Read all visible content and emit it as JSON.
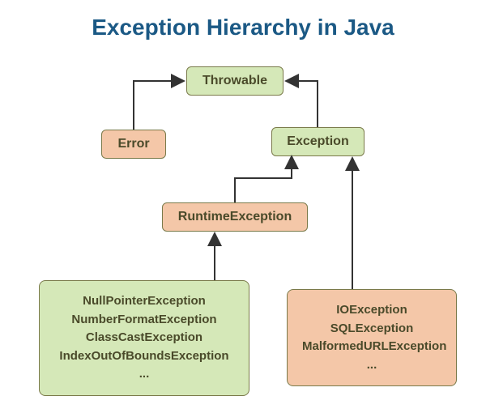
{
  "title": "Exception Hierarchy in Java",
  "nodes": {
    "throwable": "Throwable",
    "error": "Error",
    "exception": "Exception",
    "runtime": "RuntimeException"
  },
  "runtime_children": {
    "items": [
      "NullPointerException",
      "NumberFormatException",
      "ClassCastException",
      "IndexOutOfBoundsException",
      "..."
    ]
  },
  "exception_children": {
    "items": [
      "IOException",
      "SQLException",
      "MalformedURLException",
      "..."
    ]
  }
}
